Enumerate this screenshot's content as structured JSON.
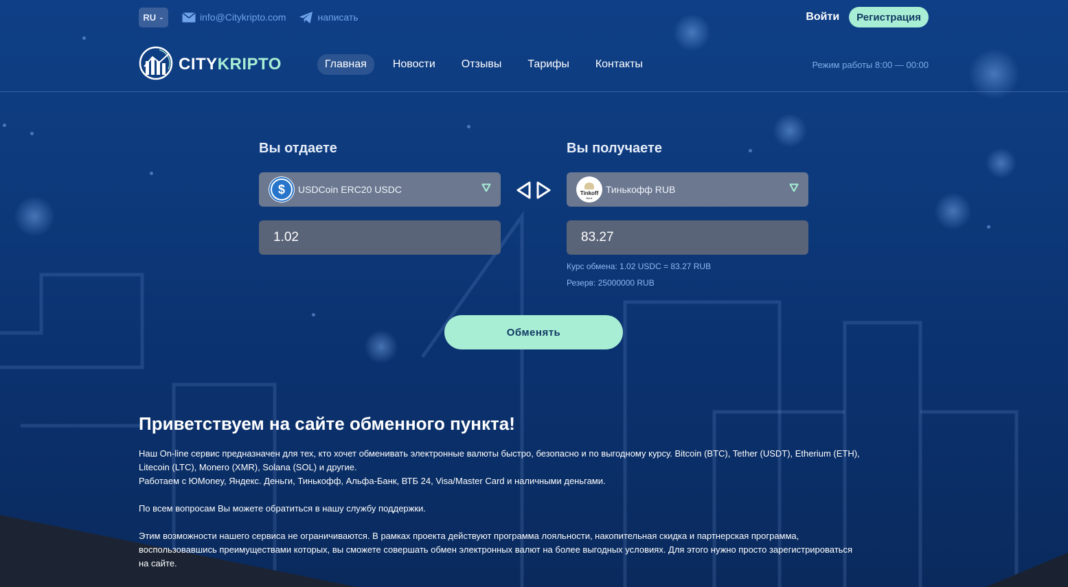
{
  "colors": {
    "background": "#0d3a7c",
    "accent": "#a8eed5",
    "link": "#6fa3ea",
    "muted_info": "#8fbaf0",
    "select_bg": "#6b7890",
    "amount_bg": "#5a6478"
  },
  "topbar": {
    "language": "RU",
    "email": "info@Citykripto.com",
    "email_icon": "envelope-icon",
    "telegram": "написать",
    "telegram_icon": "telegram-icon",
    "login": "Войти",
    "register": "Регистрация"
  },
  "brand": {
    "name_part1": "CITY",
    "name_part2": "KRIPTO",
    "logo_icon": "city-bars-logo-icon"
  },
  "nav": {
    "items": [
      "Главная",
      "Новости",
      "Отзывы",
      "Тарифы",
      "Контакты"
    ],
    "active_index": 0
  },
  "hours": "Режим работы 8:00 — 00:00",
  "exchange": {
    "give": {
      "title": "Вы отдаете",
      "currency": "USDCoin ERC20 USDC",
      "currency_icon": "usdc-coin-icon",
      "amount": "1.02"
    },
    "receive": {
      "title": "Вы получаете",
      "currency": "Тинькофф RUB",
      "currency_icon": "tinkoff-bank-icon",
      "amount": "83.27",
      "logo_text": "Tinkoff",
      "logo_subtext": "Bank"
    },
    "swap_icon": "swap-arrows-icon",
    "rate": "Курс обмена: 1.02 USDC = 83.27 RUB",
    "reserve": "Резерв: 25000000 RUB",
    "submit": "Обменять"
  },
  "welcome": {
    "heading": "Приветствуем на сайте обменного пункта!",
    "p1_line1": "Наш On-line сервис предназначен для тех, кто хочет обменивать электронные валюты быстро, безопасно и по выгодному курсу. Bitcoin (BTC), Tether (USDT), Etherium (ETH),",
    "p1_line2": "Litecoin (LTC), Monero (XMR), Solana (SOL) и другие.",
    "p1_line3": "Работаем с ЮMoney, Яндекс. Деньги, Тинькофф, Альфа-Банк, ВТБ 24, Visa/Master Card и наличными деньгами.",
    "p2": "По всем вопросам Вы можете обратиться в нашу службу поддержки.",
    "p3_line1": "Этим возможности нашего сервиса не ограничиваются. В рамках проекта действуют программа лояльности, накопительная скидка и партнерская программа,",
    "p3_line2": "воспользовавшись преимуществами которых, вы сможете совершать обмен электронных валют на более выгодных условиях. Для этого нужно просто зарегистрироваться",
    "p3_line3": "на сайте."
  }
}
